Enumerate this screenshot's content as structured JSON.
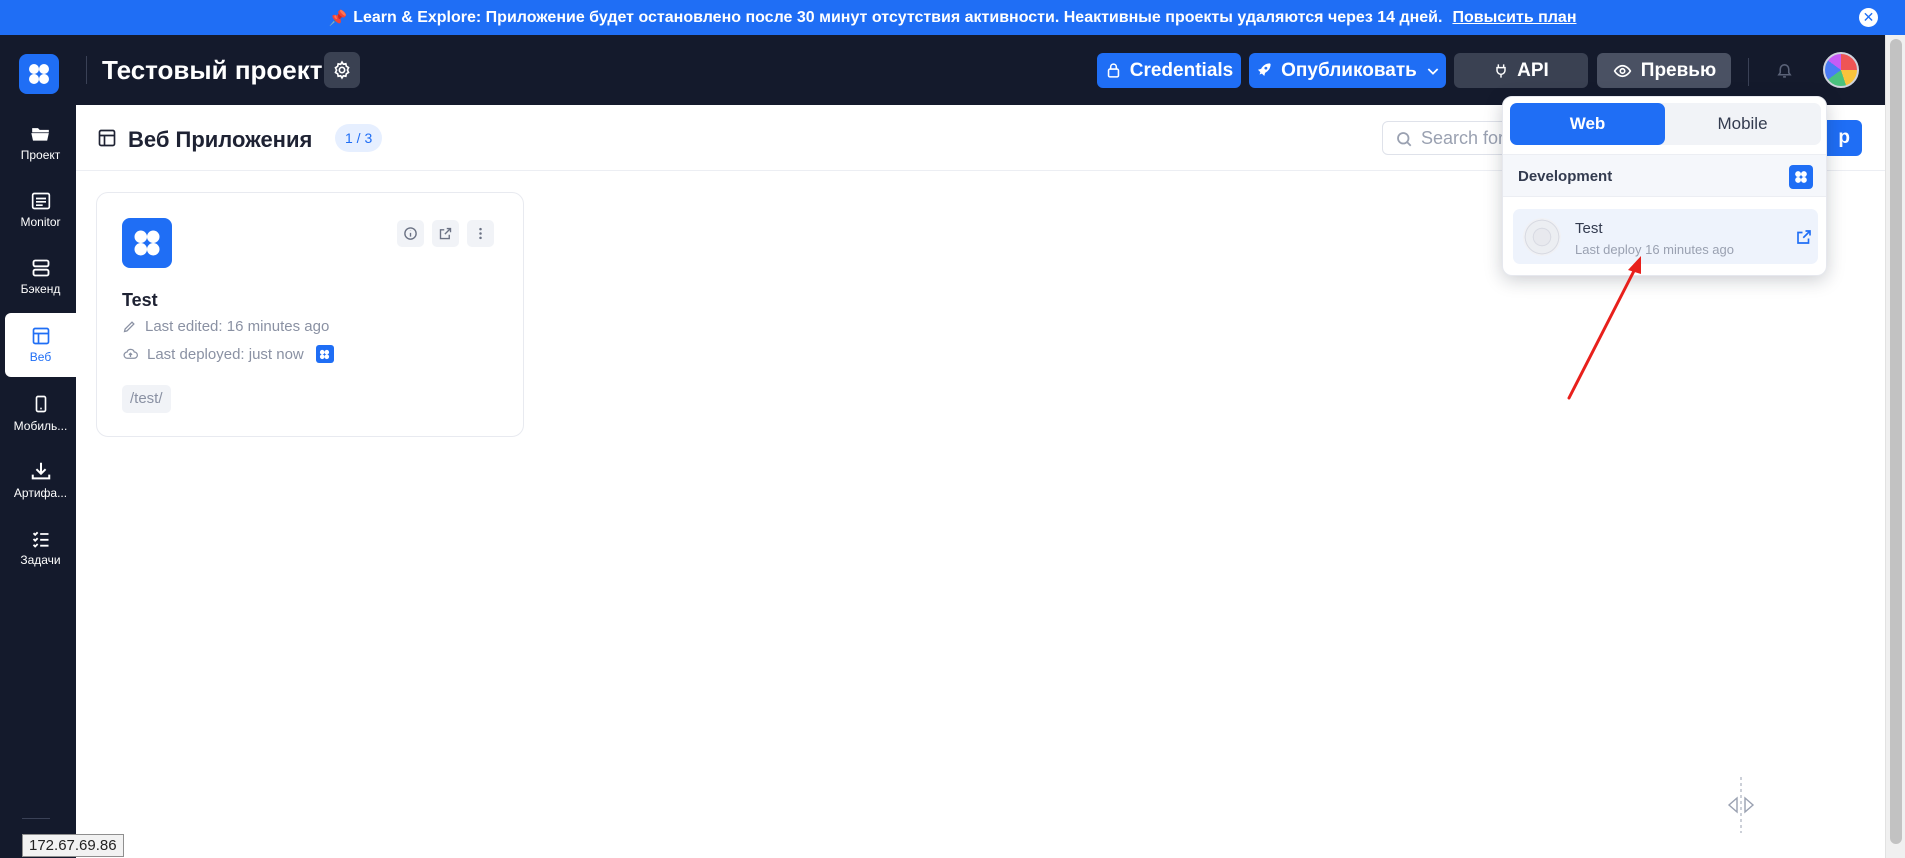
{
  "banner": {
    "pin": "📌",
    "text": "Learn & Explore: Приложение будет остановлено после 30 минут отсутствия активности. Неактивные проекты удаляются через 14 дней.",
    "link": "Повысить план",
    "close": "✕"
  },
  "header": {
    "project_title": "Тестовый проект",
    "credentials_label": "Credentials",
    "publish_label": "Опубликовать",
    "api_label": "API",
    "preview_label": "Превью"
  },
  "sidebar": {
    "items": [
      {
        "label": "Проект",
        "icon": "folder-icon"
      },
      {
        "label": "Monitor",
        "icon": "monitor-icon"
      },
      {
        "label": "Бэкенд",
        "icon": "server-icon"
      },
      {
        "label": "Веб",
        "icon": "layout-icon",
        "active": true
      },
      {
        "label": "Мобиль...",
        "icon": "mobile-icon"
      },
      {
        "label": "Артифа...",
        "icon": "download-icon"
      },
      {
        "label": "Задачи",
        "icon": "tasks-icon"
      }
    ]
  },
  "main": {
    "page_title": "Веб Приложения",
    "count": "1 / 3",
    "search_placeholder": "Search for",
    "new_button_label": "p"
  },
  "card": {
    "name": "Test",
    "last_edited": "Last edited: 16 minutes ago",
    "last_deployed": "Last deployed: just now",
    "path": "/test/"
  },
  "dropdown": {
    "tab_web": "Web",
    "tab_mobile": "Mobile",
    "section_label": "Development",
    "item_name": "Test",
    "item_sub": "Last deploy 16 minutes ago"
  },
  "status_url": "172.67.69.86",
  "colors": {
    "accent": "#1f6ef5",
    "header_bg": "#141a2c",
    "annotation": "#e8201c"
  }
}
